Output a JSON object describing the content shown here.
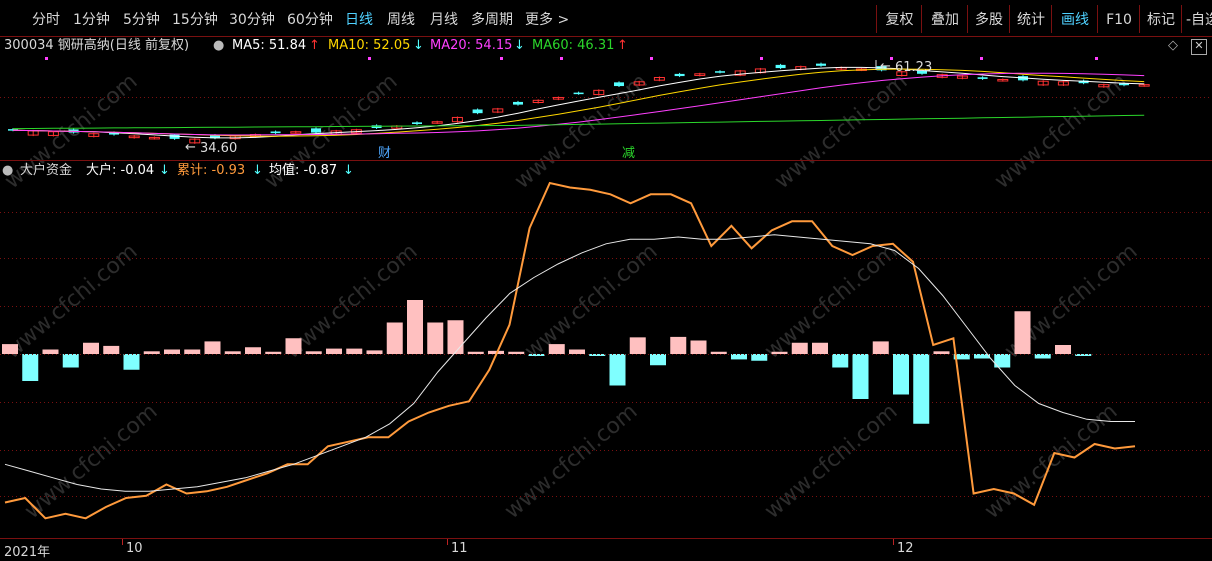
{
  "toolbar": {
    "left_items": [
      {
        "label": "分时",
        "active": false
      },
      {
        "label": "1分钟",
        "active": false
      },
      {
        "label": "5分钟",
        "active": false
      },
      {
        "label": "15分钟",
        "active": false
      },
      {
        "label": "30分钟",
        "active": false
      },
      {
        "label": "60分钟",
        "active": false
      },
      {
        "label": "日线",
        "active": true
      },
      {
        "label": "周线",
        "active": false
      },
      {
        "label": "月线",
        "active": false
      },
      {
        "label": "多周期",
        "active": false
      },
      {
        "label": "更多 >",
        "active": false
      }
    ],
    "right_items": [
      {
        "label": "复权",
        "active": false
      },
      {
        "label": "叠加",
        "active": false
      },
      {
        "label": "多股",
        "active": false
      },
      {
        "label": "统计",
        "active": false
      },
      {
        "label": "画线",
        "active": true
      },
      {
        "label": "F10",
        "active": false
      },
      {
        "label": "标记",
        "active": false
      },
      {
        "label": "-自选",
        "active": false
      }
    ]
  },
  "stock": {
    "title": "300034 钢研高纳(日线 前复权)",
    "ma5_label": "MA5: 51.84",
    "ma5_arrow": "↑",
    "ma10_label": "MA10: 52.05",
    "ma10_arrow": "↓",
    "ma20_label": "MA20: 54.15",
    "ma20_arrow": "↓",
    "ma60_label": "MA60: 46.31",
    "ma60_arrow": "↑",
    "high_label": "61.23",
    "low_label": "34.60",
    "event_cai": "财",
    "event_jian": "减"
  },
  "indicator": {
    "name": "大户资金",
    "dahu_label": "大户: -0.04",
    "dahu_arrow": "↓",
    "leiji_label": "累计: -0.93",
    "leiji_arrow": "↓",
    "junzhi_label": "均值: -0.87",
    "junzhi_arrow": "↓"
  },
  "axis": {
    "labels": [
      "2021年",
      "10",
      "11",
      "12"
    ]
  },
  "watermark": "www.cfchi.com",
  "colors": {
    "accent": "#4fd1ff",
    "ma5": "#ffffff",
    "ma10": "#ffd700",
    "ma20": "#ff40ff",
    "ma60": "#2bd62b",
    "up": "#ff3232",
    "down": "#54ffff",
    "cumulative": "#ff9a3c",
    "average": "#e8e8e8",
    "bar_pos": "#ffc0c0",
    "bar_neg": "#7fffff",
    "grid": "#7a1010"
  },
  "chart_data": {
    "type": "bar",
    "title": "大户资金",
    "xlabel": "",
    "ylabel": "",
    "categories": [
      "2021年",
      "10",
      "11",
      "12"
    ],
    "series": [
      {
        "name": "大户",
        "values": [
          0.22,
          -0.6,
          0.1,
          -0.3,
          0.25,
          0.18,
          -0.35,
          0.06,
          0.1,
          0.1,
          0.28,
          0.06,
          0.15,
          0.05,
          0.35,
          0.06,
          0.12,
          0.12,
          0.08,
          0.7,
          1.2,
          0.7,
          0.75,
          0.05,
          0.07,
          0.05,
          -0.04,
          0.22,
          0.1,
          -0.02,
          -0.7,
          0.37,
          -0.25,
          0.38,
          0.3,
          0.05,
          -0.12,
          -0.15,
          0.05,
          0.25,
          0.25,
          -0.3,
          -1.0,
          0.28,
          -0.9,
          -1.55,
          0.06,
          -0.12,
          -0.1,
          -0.3,
          0.95,
          -0.1,
          0.2,
          -0.04
        ]
      },
      {
        "name": "累计",
        "values": [
          -3.3,
          -3.2,
          -3.65,
          -3.55,
          -3.65,
          -3.4,
          -3.2,
          -3.15,
          -2.9,
          -3.1,
          -3.05,
          -2.95,
          -2.8,
          -2.65,
          -2.45,
          -2.45,
          -2.05,
          -1.95,
          -1.85,
          -1.85,
          -1.5,
          -1.3,
          -1.15,
          -1.05,
          -0.35,
          0.65,
          2.8,
          3.8,
          3.7,
          3.65,
          3.55,
          3.35,
          3.55,
          3.55,
          3.35,
          2.4,
          2.85,
          2.35,
          2.75,
          2.95,
          2.95,
          2.4,
          2.2,
          2.4,
          2.45,
          2.05,
          0.2,
          0.35,
          -3.1,
          -3.0,
          -3.1,
          -3.35,
          -2.2,
          -2.3,
          -2.0,
          -2.1,
          -2.05
        ]
      },
      {
        "name": "均值",
        "values": [
          -2.45,
          -2.6,
          -2.75,
          -2.9,
          -3.0,
          -3.05,
          -3.05,
          -3.0,
          -2.95,
          -2.85,
          -2.75,
          -2.6,
          -2.45,
          -2.25,
          -2.05,
          -1.85,
          -1.55,
          -1.1,
          -0.4,
          0.2,
          0.8,
          1.35,
          1.7,
          2.0,
          2.25,
          2.45,
          2.55,
          2.55,
          2.6,
          2.55,
          2.55,
          2.6,
          2.65,
          2.6,
          2.55,
          2.5,
          2.45,
          2.3,
          1.9,
          1.3,
          0.6,
          -0.1,
          -0.7,
          -1.1,
          -1.3,
          -1.45,
          -1.5,
          -1.5
        ]
      }
    ]
  }
}
